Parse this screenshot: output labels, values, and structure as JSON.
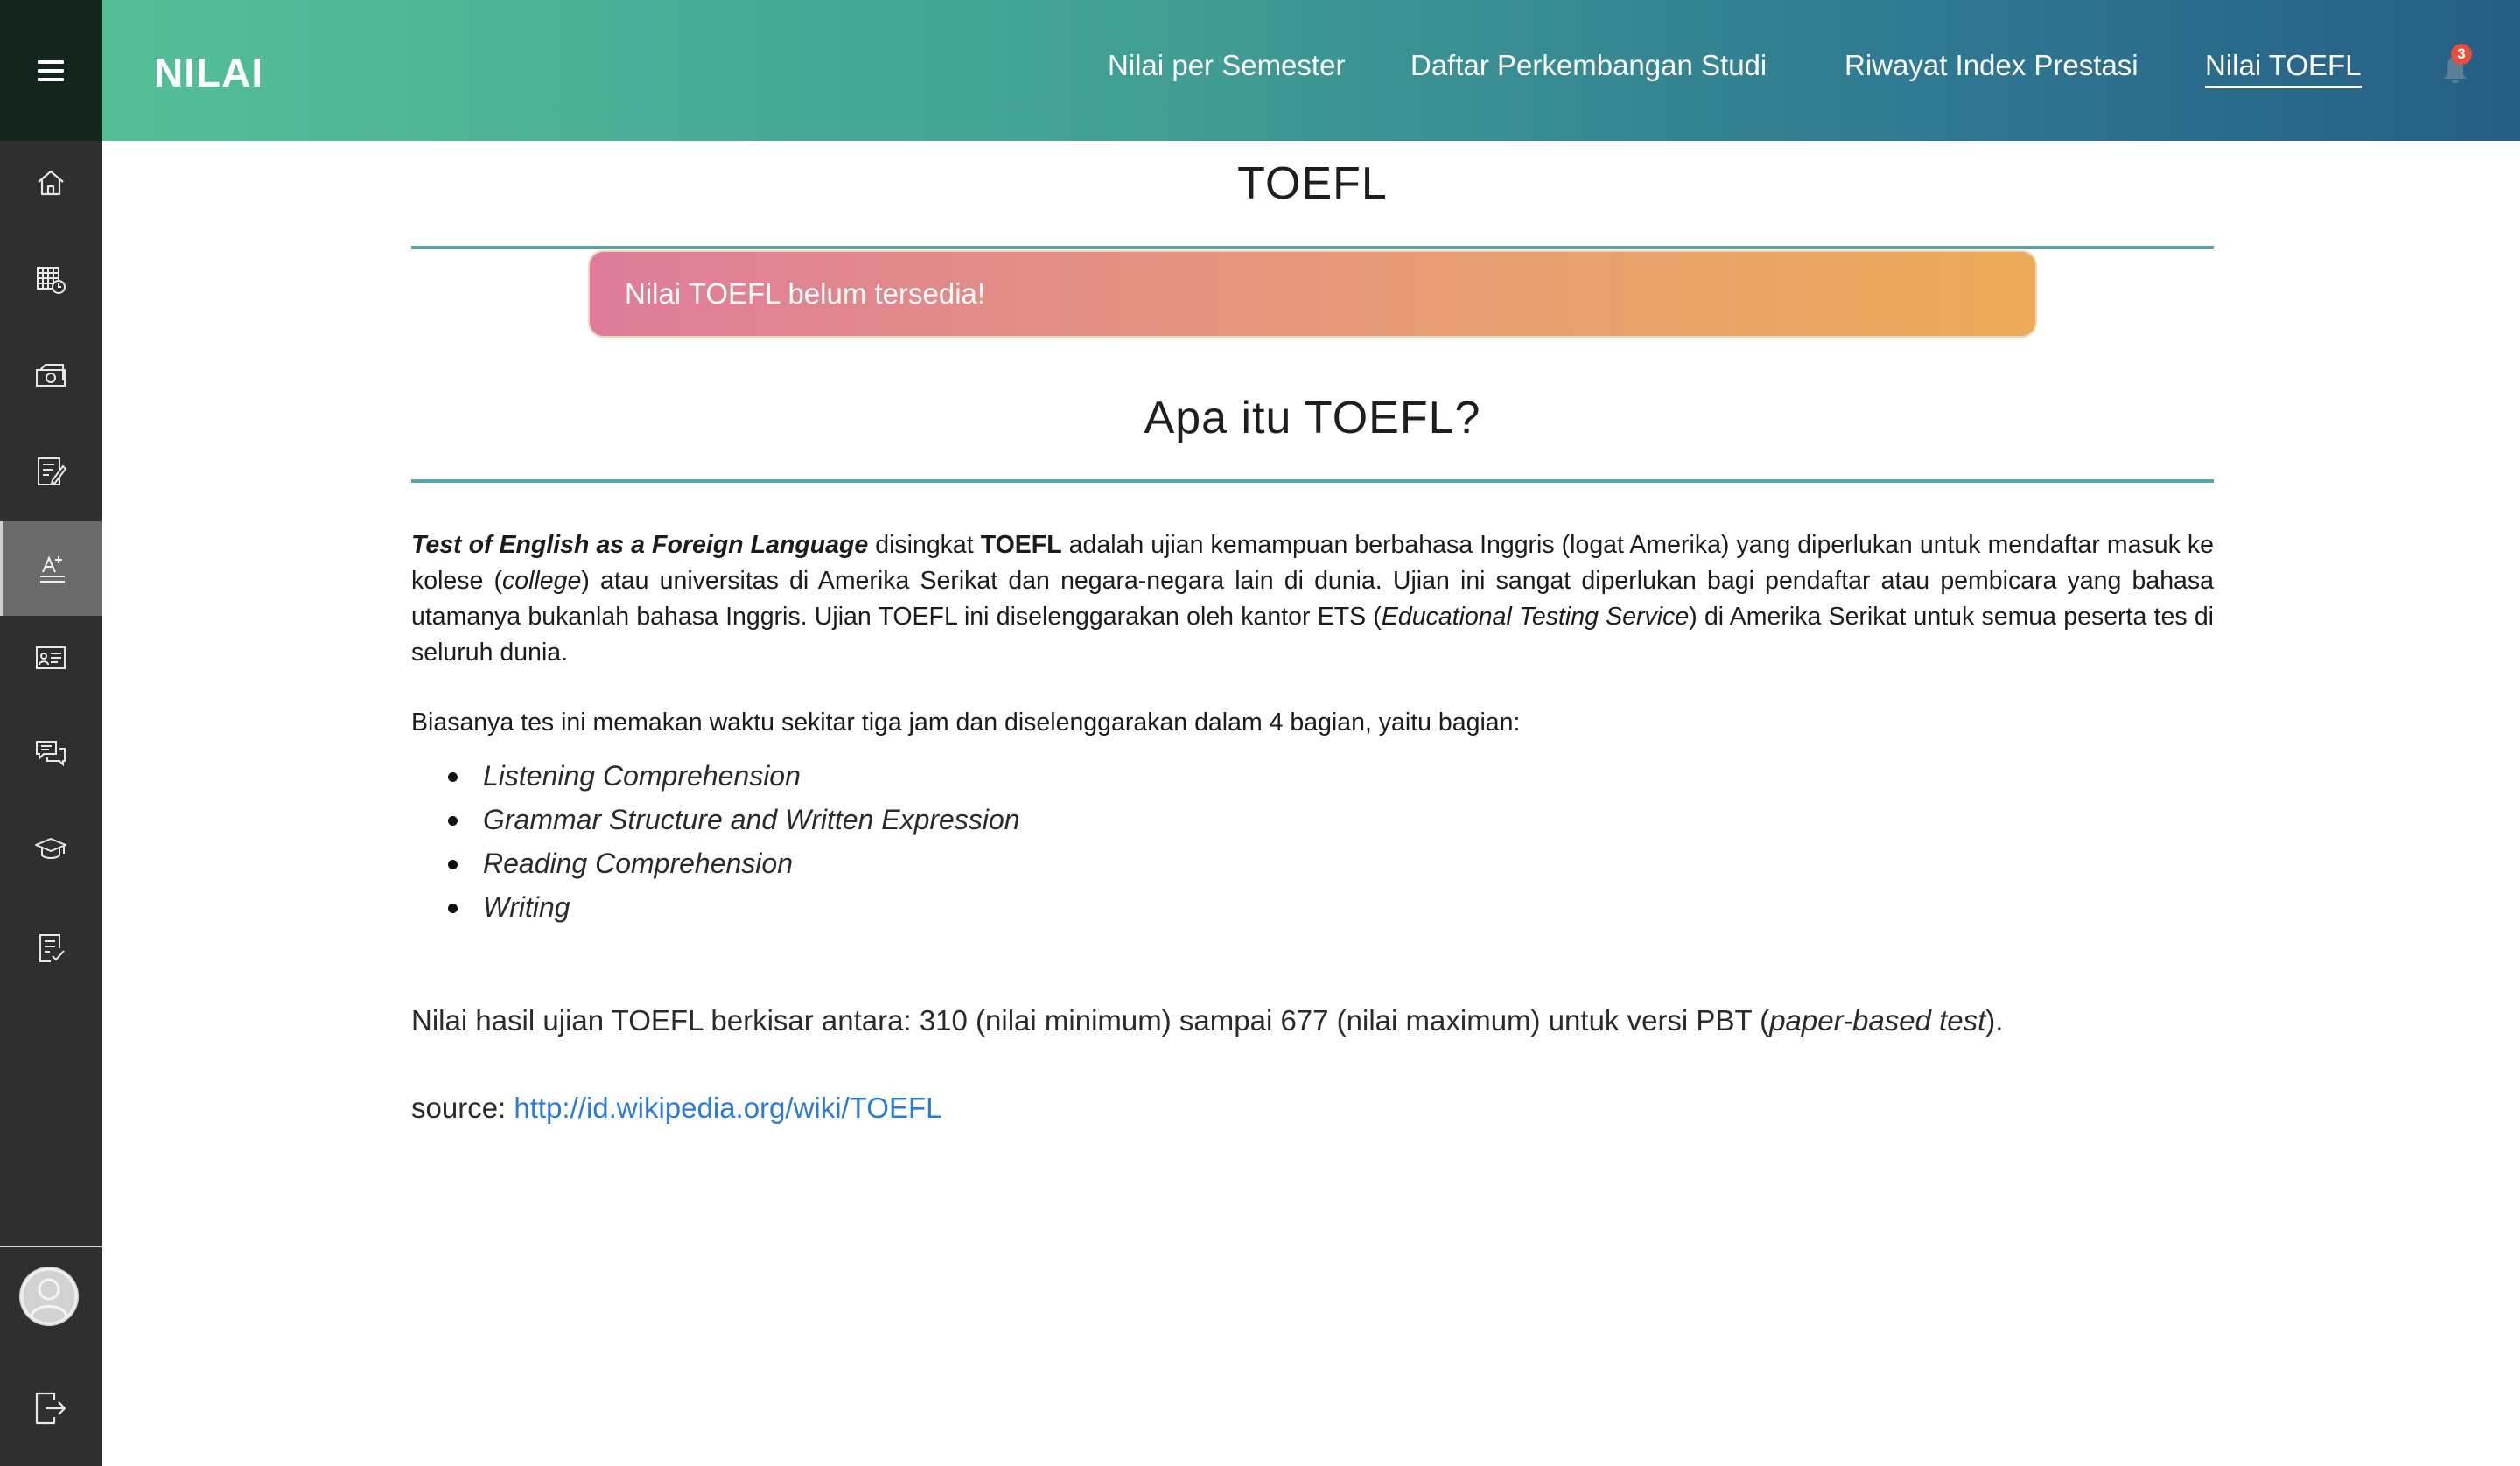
{
  "header": {
    "brand": "NILAI",
    "nav": [
      {
        "label": "Nilai per Semester"
      },
      {
        "label": "Daftar Perkembangan Studi"
      },
      {
        "label": "Riwayat Index Prestasi"
      },
      {
        "label": "Nilai TOEFL",
        "active": true
      }
    ],
    "notification_count": "3"
  },
  "sidebar": {
    "items": [
      {
        "icon": "home-icon"
      },
      {
        "icon": "calendar-clock-icon"
      },
      {
        "icon": "money-icon"
      },
      {
        "icon": "document-edit-icon"
      },
      {
        "icon": "grade-a-plus-icon",
        "active": true
      },
      {
        "icon": "presentation-icon"
      },
      {
        "icon": "chat-icon"
      },
      {
        "icon": "graduation-cap-icon"
      },
      {
        "icon": "checklist-icon"
      }
    ],
    "bottom": [
      "avatar-icon",
      "logout-icon"
    ]
  },
  "main": {
    "title": "TOEFL",
    "alert": "Nilai TOEFL belum tersedia!",
    "subtitle": "Apa itu TOEFL?",
    "description": {
      "term": "Test of English as a Foreign Language",
      "t1": " disingkat ",
      "abbr": "TOEFL",
      "t2": " adalah ujian kemampuan berbahasa Inggris (logat Amerika) yang diperlukan untuk mendaftar masuk ke kolese (",
      "college": "college",
      "t3": ") atau universitas di Amerika Serikat dan negara-negara lain di dunia. Ujian ini sangat diperlukan bagi pendaftar atau pembicara yang bahasa utamanya bukanlah bahasa Inggris. Ujian TOEFL ini diselenggarakan oleh kantor ETS (",
      "ets": "Educational Testing Service",
      "t4": ") di Amerika Serikat untuk semua peserta tes di seluruh dunia."
    },
    "sections_intro": "Biasanya tes ini memakan waktu sekitar tiga jam dan diselenggarakan dalam 4 bagian, yaitu bagian:",
    "sections": [
      "Listening Comprehension",
      "Grammar Structure and Written Expression",
      "Reading Comprehension",
      "Writing"
    ],
    "range": {
      "prefix": "Nilai hasil ujian TOEFL berkisar antara: 310 (nilai minimum) sampai 677 (nilai maximum) untuk versi PBT (",
      "italic": "paper-based test",
      "suffix": ")."
    },
    "source": {
      "label": "source: ",
      "link": "http://id.wikipedia.org/wiki/TOEFL"
    }
  }
}
